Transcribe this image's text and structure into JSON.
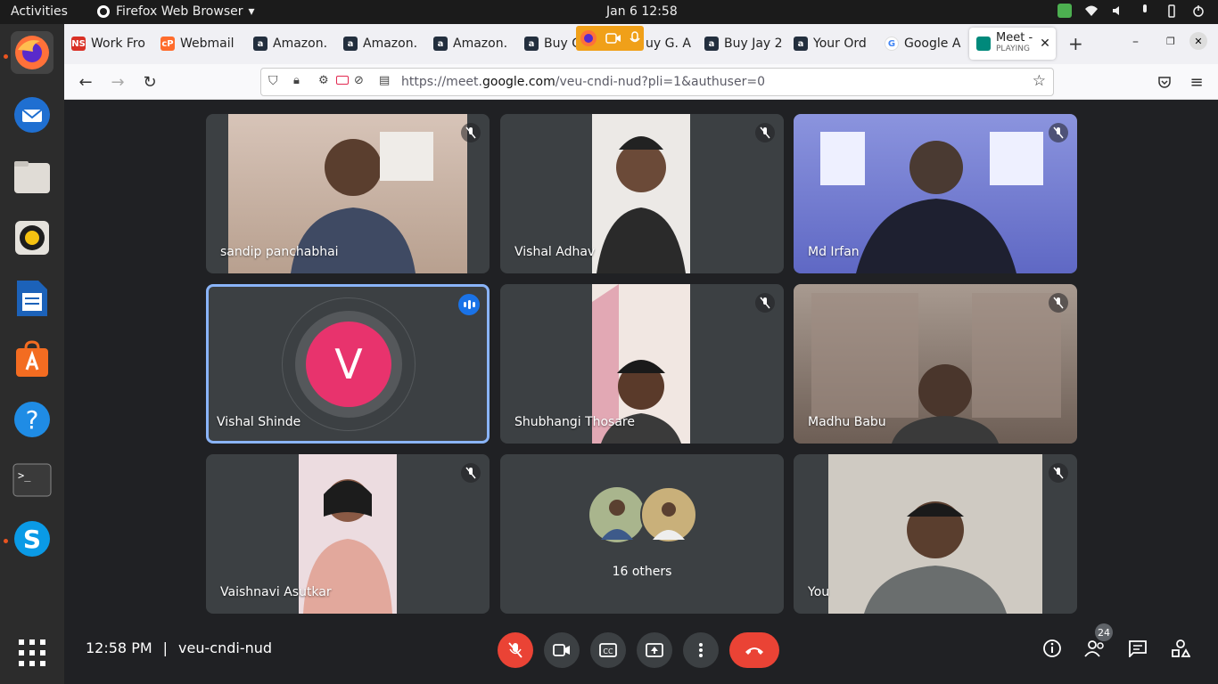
{
  "topbar": {
    "activities": "Activities",
    "app_name": "Firefox Web Browser",
    "clock": "Jan 6  12:58"
  },
  "dock": {
    "items": [
      "firefox-icon",
      "thunderbird-icon",
      "files-icon",
      "rhythmbox-icon",
      "writer-icon",
      "software-icon",
      "help-icon",
      "terminal-icon",
      "skype-icon",
      "app-grid-icon"
    ]
  },
  "tabs": [
    {
      "label": "Work Fro",
      "favicon": "NS",
      "color": "#d93025"
    },
    {
      "label": "Webmail",
      "favicon": "cP",
      "color": "#ff6c2c"
    },
    {
      "label": "Amazon.",
      "favicon": "a",
      "color": "#232f3e"
    },
    {
      "label": "Amazon.",
      "favicon": "a",
      "color": "#232f3e"
    },
    {
      "label": "Amazon.",
      "favicon": "a",
      "color": "#232f3e"
    },
    {
      "label": "Buy G",
      "favicon": "a",
      "color": "#232f3e"
    },
    {
      "label": "uy G. A",
      "favicon": "",
      "color": "#ff9800"
    },
    {
      "label": "Buy Jay 2",
      "favicon": "a",
      "color": "#232f3e"
    },
    {
      "label": "Your Ord",
      "favicon": "a",
      "color": "#232f3e"
    },
    {
      "label": "Google A",
      "favicon": "G",
      "color": "#4285f4"
    }
  ],
  "active_tab": {
    "label": "Meet -",
    "sublabel": "PLAYING"
  },
  "url": {
    "prefix": "https://meet.",
    "domain": "google.com",
    "rest": "/veu-cndi-nud?pli=1&authuser=0"
  },
  "participants": [
    {
      "name": "sandip panchabhai",
      "bg": "#c9b3a4"
    },
    {
      "name": "Vishal Adhav",
      "bg": "#e9e6e2"
    },
    {
      "name": "Md Irfan",
      "bg": "#9da4e6"
    },
    {
      "name": "Vishal Shinde",
      "initial": "V"
    },
    {
      "name": "Shubhangi Thosare",
      "bg": "#e8d6ce"
    },
    {
      "name": "Madhu Babu",
      "bg": "#b8aaa0"
    },
    {
      "name": "Vaishnavi Asutkar",
      "bg": "#e8c2bb"
    },
    {
      "name": "16 others"
    },
    {
      "name": "You",
      "bg": "#b7b5b0"
    }
  ],
  "bottom": {
    "time": "12:58 PM",
    "separator": "|",
    "meeting_code": "veu-cndi-nud",
    "people_count": "24"
  },
  "colors": {
    "accent": "#1a73e8",
    "danger": "#ea4335",
    "tile": "#3c4043"
  }
}
